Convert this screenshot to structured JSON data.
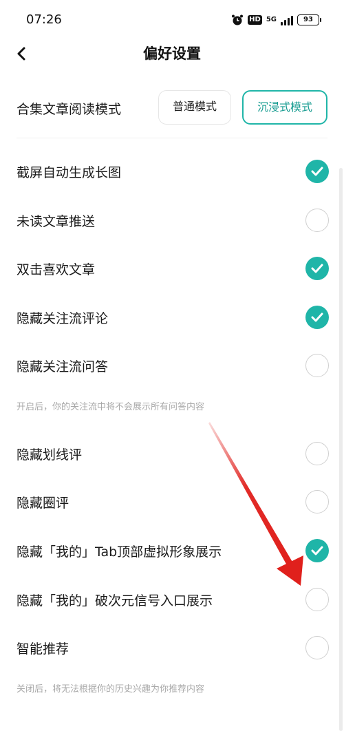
{
  "status_bar": {
    "time": "07:26",
    "network": "5G",
    "hd": "HD",
    "battery": "93"
  },
  "nav": {
    "title": "偏好设置",
    "back_icon": "back-arrow-icon"
  },
  "reading_mode": {
    "label": "合集文章阅读模式",
    "options": [
      "普通模式",
      "沉浸式模式"
    ],
    "selected": "沉浸式模式"
  },
  "settings": [
    {
      "label": "截屏自动生成长图",
      "checked": true
    },
    {
      "label": "未读文章推送",
      "checked": false
    },
    {
      "label": "双击喜欢文章",
      "checked": true
    },
    {
      "label": "隐藏关注流评论",
      "checked": true
    },
    {
      "label": "隐藏关注流问答",
      "checked": false
    },
    {
      "label": "隐藏划线评",
      "checked": false
    },
    {
      "label": "隐藏圈评",
      "checked": false
    },
    {
      "label": "隐藏「我的」Tab顶部虚拟形象展示",
      "checked": true
    },
    {
      "label": "隐藏「我的」破次元信号入口展示",
      "checked": false
    },
    {
      "label": "智能推荐",
      "checked": false
    }
  ],
  "hints": {
    "qa_hint": "开启后，你的关注流中将不会展示所有问答内容",
    "recommend_hint": "关闭后，将无法根据你的历史兴趣为你推荐内容"
  },
  "colors": {
    "accent": "#1fb5a8",
    "annotation_arrow": "#e0201c"
  }
}
